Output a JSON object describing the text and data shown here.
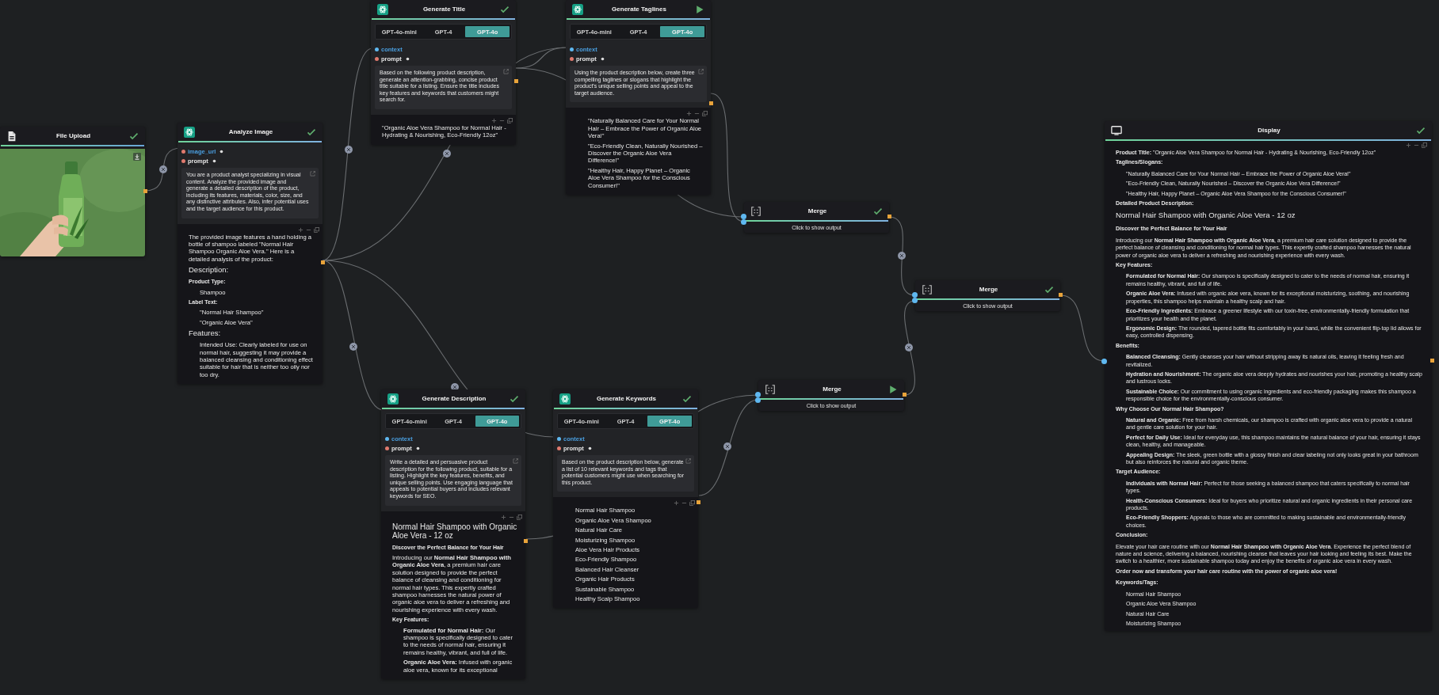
{
  "nodes": [
    {
      "kind": "file_upload",
      "title": "File Upload",
      "completed": true
    },
    {
      "kind": "llm",
      "title": "Analyze Image",
      "completed": true,
      "inputs": [
        {
          "name": "image_url",
          "required": true,
          "connected": true
        },
        {
          "name": "prompt",
          "required": true,
          "connected": false
        }
      ],
      "prompt": "You are a product analyst specializing in visual content. Analyze the provided image and generate a detailed description of the product, including its features, materials, color, size, and any distinctive attributes. Also, infer potential uses and the target audience for this product.",
      "output": [
        {
          "kind": "p",
          "text": "The provided image features a hand holding a bottle of shampoo labeled \"Normal Hair Shampoo Organic Aloe Vera.\" Here is a detailed analysis of the product:"
        },
        {
          "kind": "h2",
          "text": "Description:"
        },
        {
          "kind": "label",
          "text": "Product Type:"
        },
        {
          "kind": "item",
          "text": "Shampoo"
        },
        {
          "kind": "label",
          "text": "Label Text:"
        },
        {
          "kind": "item",
          "text": "\"Normal Hair Shampoo\""
        },
        {
          "kind": "item",
          "text": "\"Organic Aloe Vera\""
        },
        {
          "kind": "h2",
          "text": "Features:"
        },
        {
          "kind": "item",
          "text": "Intended Use: Clearly labeled for use on normal hair, suggesting it may provide a balanced cleansing and conditioning effect suitable for hair that is neither too oily nor too dry."
        }
      ]
    },
    {
      "kind": "llm",
      "title": "Generate Title",
      "completed": true,
      "models": [
        {
          "label": "GPT-4o-mini",
          "selected": false
        },
        {
          "label": "GPT-4",
          "selected": false
        },
        {
          "label": "GPT-4o",
          "selected": true
        }
      ],
      "inputs": [
        {
          "name": "context",
          "required": false,
          "connected": true
        },
        {
          "name": "prompt",
          "required": true,
          "connected": false
        }
      ],
      "prompt": "Based on the following product description, generate an attention-grabbing, concise product title suitable for a listing. Ensure the title includes key features and keywords that customers might search for.",
      "output": [
        {
          "kind": "p",
          "text": "\"Organic Aloe Vera Shampoo for Normal Hair - Hydrating & Nourishing, Eco-Friendly 12oz\""
        }
      ]
    },
    {
      "kind": "llm",
      "title": "Generate Taglines",
      "completed": false,
      "models": [
        {
          "label": "GPT-4o-mini",
          "selected": false
        },
        {
          "label": "GPT-4",
          "selected": false
        },
        {
          "label": "GPT-4o",
          "selected": true
        }
      ],
      "inputs": [
        {
          "name": "context",
          "required": false,
          "connected": true
        },
        {
          "name": "prompt",
          "required": true,
          "connected": false
        }
      ],
      "prompt": "Using the product description below, create three compelling taglines or slogans that highlight the product's unique selling points and appeal to the target audience.",
      "output": [
        {
          "kind": "item",
          "text": "\"Naturally Balanced Care for Your Normal Hair – Embrace the Power of Organic Aloe Vera!\""
        },
        {
          "kind": "item",
          "text": "\"Eco-Friendly Clean, Naturally Nourished – Discover the Organic Aloe Vera Difference!\""
        },
        {
          "kind": "item",
          "text": "\"Healthy Hair, Happy Planet – Organic Aloe Vera Shampoo for the Conscious Consumer!\""
        }
      ]
    },
    {
      "kind": "merge",
      "title": "Merge",
      "completed": true,
      "hint": "Click to show output"
    },
    {
      "kind": "llm",
      "title": "Generate Description",
      "completed": true,
      "models": [
        {
          "label": "GPT-4o-mini",
          "selected": false
        },
        {
          "label": "GPT-4",
          "selected": false
        },
        {
          "label": "GPT-4o",
          "selected": true
        }
      ],
      "inputs": [
        {
          "name": "context",
          "required": false,
          "connected": true
        },
        {
          "name": "prompt",
          "required": true,
          "connected": false
        }
      ],
      "prompt": "Write a detailed and persuasive product description for the following product, suitable for a listing. Highlight the key features, benefits, and unique selling points. Use engaging language that appeals to potential buyers and includes relevant keywords for SEO.",
      "output": [
        {
          "kind": "h1",
          "text": "Normal Hair Shampoo with Organic Aloe Vera - 12 oz"
        },
        {
          "kind": "label",
          "text": "Discover the Perfect Balance for Your Hair"
        },
        {
          "kind": "p",
          "text": "Introducing our **Normal Hair Shampoo with Organic Aloe Vera**, a premium hair care solution designed to provide the perfect balance of cleansing and conditioning for normal hair types. This expertly crafted shampoo harnesses the natural power of organic aloe vera to deliver a refreshing and nourishing experience with every wash."
        },
        {
          "kind": "label",
          "text": "Key Features:"
        },
        {
          "kind": "item",
          "text": "**Formulated for Normal Hair:** Our shampoo is specifically designed to cater to the needs of normal hair, ensuring it remains healthy, vibrant, and full of life."
        },
        {
          "kind": "item",
          "text": "**Organic Aloe Vera:** Infused with organic aloe vera, known for its exceptional"
        }
      ]
    },
    {
      "kind": "llm",
      "title": "Generate Keywords",
      "completed": true,
      "models": [
        {
          "label": "GPT-4o-mini",
          "selected": false
        },
        {
          "label": "GPT-4",
          "selected": false
        },
        {
          "label": "GPT-4o",
          "selected": true
        }
      ],
      "inputs": [
        {
          "name": "context",
          "required": false,
          "connected": true
        },
        {
          "name": "prompt",
          "required": true,
          "connected": false
        }
      ],
      "prompt": "Based on the product description below, generate a list of 10 relevant keywords and tags that potential customers might use when searching for this product.",
      "output": [
        {
          "kind": "item",
          "text": "Normal Hair Shampoo"
        },
        {
          "kind": "item",
          "text": "Organic Aloe Vera Shampoo"
        },
        {
          "kind": "item",
          "text": "Natural Hair Care"
        },
        {
          "kind": "item",
          "text": "Moisturizing Shampoo"
        },
        {
          "kind": "item",
          "text": "Aloe Vera Hair Products"
        },
        {
          "kind": "item",
          "text": "Eco-Friendly Shampoo"
        },
        {
          "kind": "item",
          "text": "Balanced Hair Cleanser"
        },
        {
          "kind": "item",
          "text": "Organic Hair Products"
        },
        {
          "kind": "item",
          "text": "Sustainable Shampoo"
        },
        {
          "kind": "item",
          "text": "Healthy Scalp Shampoo"
        }
      ]
    },
    {
      "kind": "merge",
      "title": "Merge",
      "completed": false,
      "hint": "Click to show output"
    },
    {
      "kind": "merge",
      "title": "Merge",
      "completed": true,
      "hint": "Click to show output"
    },
    {
      "kind": "display",
      "title": "Display",
      "completed": true,
      "output": [
        {
          "kind": "p",
          "text": "**Product Title:** \"Organic Aloe Vera Shampoo for Normal Hair - Hydrating & Nourishing, Eco-Friendly 12oz\""
        },
        {
          "kind": "label",
          "text": "Taglines/Slogans:"
        },
        {
          "kind": "item",
          "text": "\"Naturally Balanced Care for Your Normal Hair – Embrace the Power of Organic Aloe Vera!\""
        },
        {
          "kind": "item",
          "text": "\"Eco-Friendly Clean, Naturally Nourished – Discover the Organic Aloe Vera Difference!\""
        },
        {
          "kind": "item",
          "text": "\"Healthy Hair, Happy Planet – Organic Aloe Vera Shampoo for the Conscious Consumer!\""
        },
        {
          "kind": "label",
          "text": "Detailed Product Description:"
        },
        {
          "kind": "h1",
          "text": "Normal Hair Shampoo with Organic Aloe Vera - 12 oz"
        },
        {
          "kind": "label",
          "text": "Discover the Perfect Balance for Your Hair"
        },
        {
          "kind": "p",
          "text": "Introducing our **Normal Hair Shampoo with Organic Aloe Vera**, a premium hair care solution designed to provide the perfect balance of cleansing and conditioning for normal hair types. This expertly crafted shampoo harnesses the natural power of organic aloe vera to deliver a refreshing and nourishing experience with every wash."
        },
        {
          "kind": "label",
          "text": "Key Features:"
        },
        {
          "kind": "item",
          "text": "**Formulated for Normal Hair:** Our shampoo is specifically designed to cater to the needs of normal hair, ensuring it remains healthy, vibrant, and full of life."
        },
        {
          "kind": "item",
          "text": "**Organic Aloe Vera:** Infused with organic aloe vera, known for its exceptional moisturizing, soothing, and nourishing properties, this shampoo helps maintain a healthy scalp and hair."
        },
        {
          "kind": "item",
          "text": "**Eco-Friendly Ingredients:** Embrace a greener lifestyle with our toxin-free, environmentally-friendly formulation that prioritizes your health and the planet."
        },
        {
          "kind": "item",
          "text": "**Ergonomic Design:** The rounded, tapered bottle fits comfortably in your hand, while the convenient flip-top lid allows for easy, controlled dispensing."
        },
        {
          "kind": "label",
          "text": "Benefits:"
        },
        {
          "kind": "item",
          "text": "**Balanced Cleansing:** Gently cleanses your hair without stripping away its natural oils, leaving it feeling fresh and revitalized."
        },
        {
          "kind": "item",
          "text": "**Hydration and Nourishment:** The organic aloe vera deeply hydrates and nourishes your hair, promoting a healthy scalp and lustrous locks."
        },
        {
          "kind": "item",
          "text": "**Sustainable Choice:** Our commitment to using organic ingredients and eco-friendly packaging makes this shampoo a responsible choice for the environmentally-conscious consumer."
        },
        {
          "kind": "label",
          "text": "Why Choose Our Normal Hair Shampoo?"
        },
        {
          "kind": "item",
          "text": "**Natural and Organic:** Free from harsh chemicals, our shampoo is crafted with organic aloe vera to provide a natural and gentle care solution for your hair."
        },
        {
          "kind": "item",
          "text": "**Perfect for Daily Use:** Ideal for everyday use, this shampoo maintains the natural balance of your hair, ensuring it stays clean, healthy, and manageable."
        },
        {
          "kind": "item",
          "text": "**Appealing Design:** The sleek, green bottle with a glossy finish and clear labeling not only looks great in your bathroom but also reinforces the natural and organic theme."
        },
        {
          "kind": "label",
          "text": "Target Audience:"
        },
        {
          "kind": "item",
          "text": "**Individuals with Normal Hair:** Perfect for those seeking a balanced shampoo that caters specifically to normal hair types."
        },
        {
          "kind": "item",
          "text": "**Health-Conscious Consumers:** Ideal for buyers who prioritize natural and organic ingredients in their personal care products."
        },
        {
          "kind": "item",
          "text": "**Eco-Friendly Shoppers:** Appeals to those who are committed to making sustainable and environmentally-friendly choices."
        },
        {
          "kind": "label",
          "text": "Conclusion:"
        },
        {
          "kind": "p",
          "text": "Elevate your hair care routine with our **Normal Hair Shampoo with Organic Aloe Vera**. Experience the perfect blend of nature and science, delivering a balanced, nourishing cleanse that leaves your hair looking and feeling its best. Make the switch to a healthier, more sustainable shampoo today and enjoy the benefits of organic aloe vera in every wash."
        },
        {
          "kind": "label",
          "text": "Order now and transform your hair care routine with the power of organic aloe vera!"
        },
        {
          "kind": "label",
          "text": "Keywords/Tags:"
        },
        {
          "kind": "item",
          "text": "Normal Hair Shampoo"
        },
        {
          "kind": "item",
          "text": "Organic Aloe Vera Shampoo"
        },
        {
          "kind": "item",
          "text": "Natural Hair Care"
        },
        {
          "kind": "item",
          "text": "Moisturizing Shampoo"
        }
      ]
    }
  ]
}
